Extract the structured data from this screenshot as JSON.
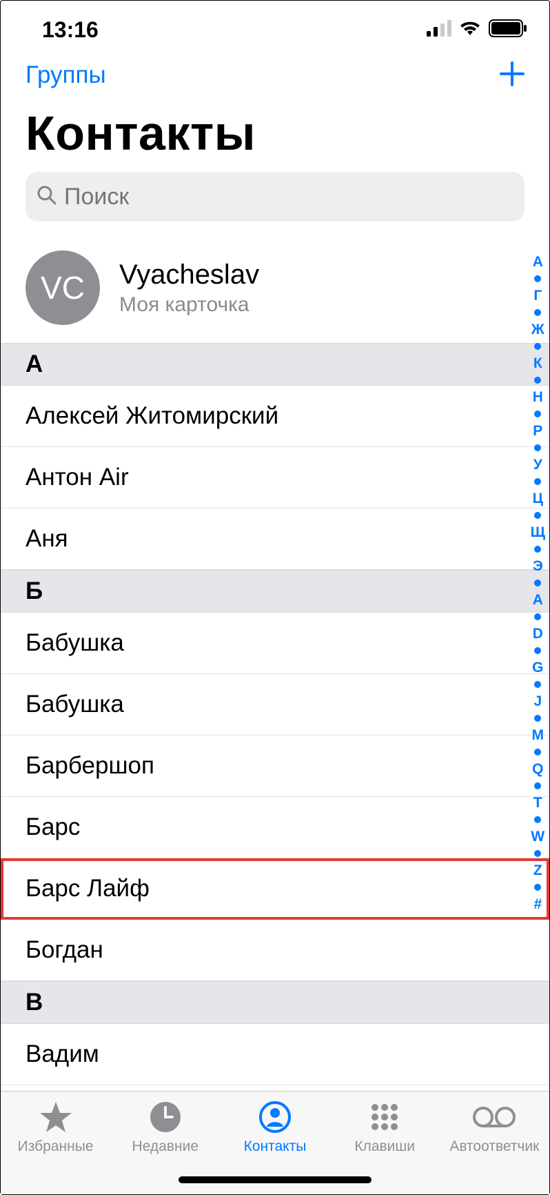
{
  "status": {
    "time": "13:16"
  },
  "nav": {
    "groups": "Группы"
  },
  "title": "Контакты",
  "search": {
    "placeholder": "Поиск"
  },
  "mycard": {
    "initials": "VC",
    "name": "Vyacheslav",
    "sub": "Моя карточка"
  },
  "sections": [
    {
      "letter": "А",
      "rows": [
        "Алексей Житомирский",
        "Антон Air",
        "Аня"
      ]
    },
    {
      "letter": "Б",
      "rows": [
        "Бабушка",
        "Бабушка",
        "Барбершоп",
        "Барс",
        "Барс Лайф",
        "Богдан"
      ]
    },
    {
      "letter": "В",
      "rows": [
        "Вадим"
      ]
    }
  ],
  "highlighted": "Барс Лайф",
  "index": [
    "А",
    "Г",
    "Ж",
    "К",
    "Н",
    "Р",
    "У",
    "Ц",
    "Щ",
    "Э",
    "A",
    "D",
    "G",
    "J",
    "M",
    "Q",
    "T",
    "W",
    "Z",
    "#"
  ],
  "tabs": {
    "favorites": "Избранные",
    "recents": "Недавние",
    "contacts": "Контакты",
    "keypad": "Клавиши",
    "voicemail": "Автоответчик",
    "active": "contacts"
  }
}
